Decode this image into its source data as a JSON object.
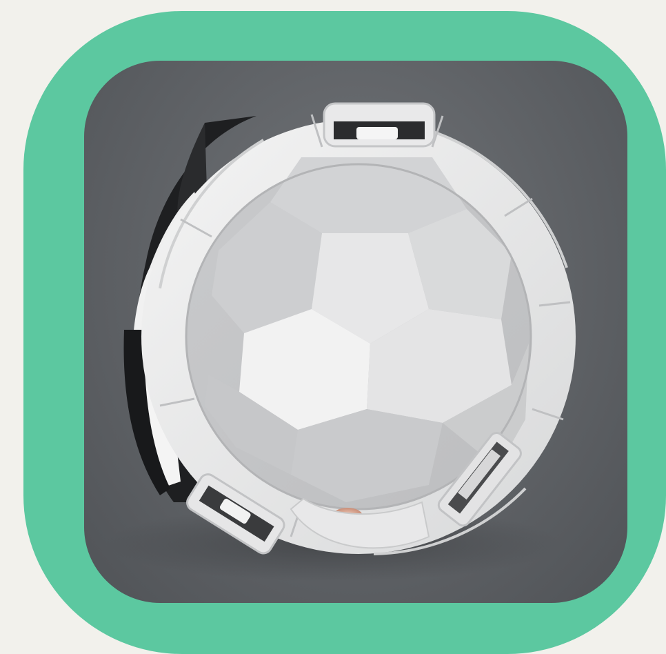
{
  "image": {
    "subject": "soccer-ball-cross-section-render",
    "frame_color": "#5cc8a0",
    "page_background": "#f2f1ec",
    "photo_background": "#63666a"
  }
}
